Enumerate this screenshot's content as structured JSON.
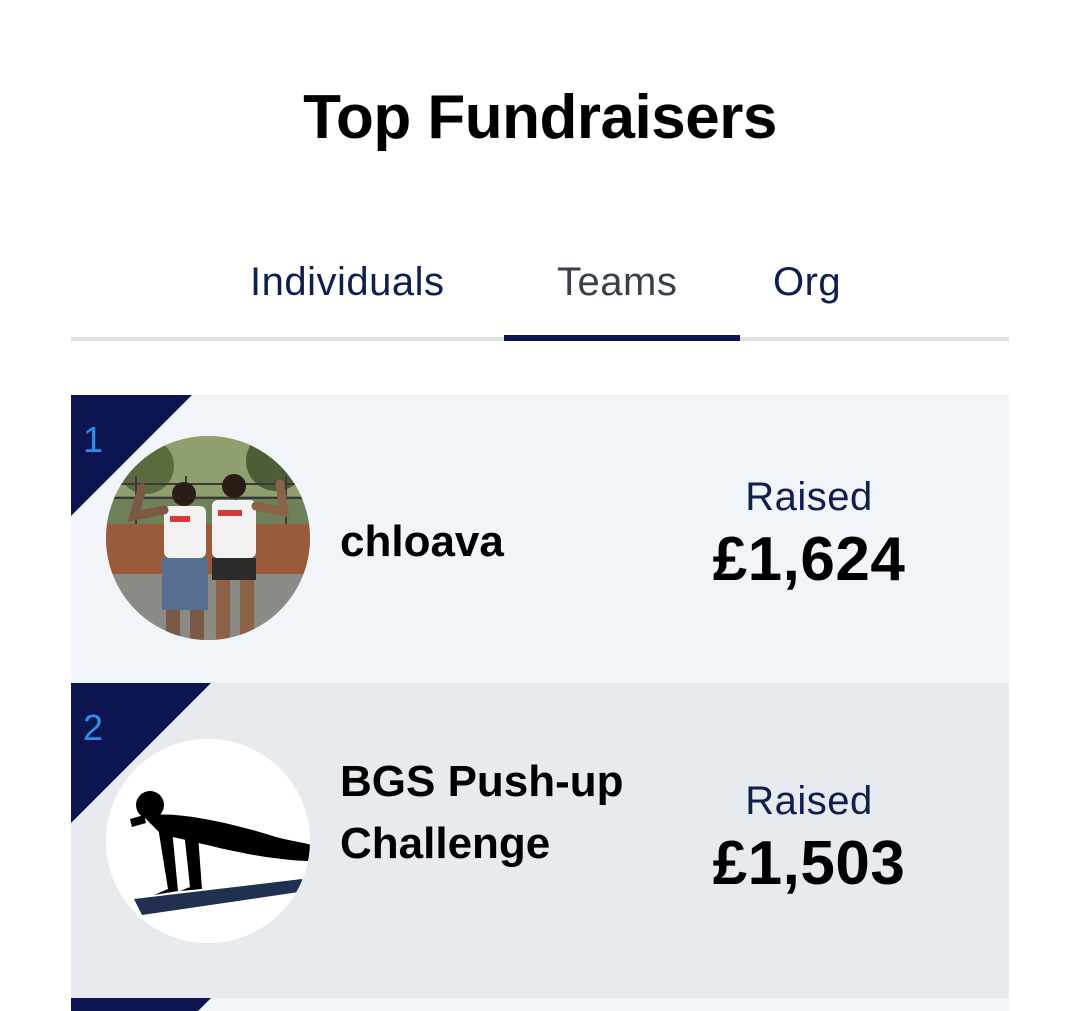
{
  "header": {
    "title": "Top Fundraisers"
  },
  "tabs": [
    {
      "label": "Individuals",
      "active": false
    },
    {
      "label": "Teams",
      "active": true
    },
    {
      "label": "Org",
      "active": false
    }
  ],
  "entries": [
    {
      "rank": "1",
      "name": "chloava",
      "raised_label": "Raised",
      "amount": "£1,624",
      "avatar": "photo-two-people-flexing"
    },
    {
      "rank": "2",
      "name": "BGS Push-up Challenge",
      "raised_label": "Raised",
      "amount": "£1,503",
      "avatar": "push-up-silhouette"
    }
  ],
  "colors": {
    "navy": "#0c1550",
    "rank_number": "#2f8ee8",
    "card_light": "#f1f4f8",
    "card_alt": "#e7ebf0"
  }
}
